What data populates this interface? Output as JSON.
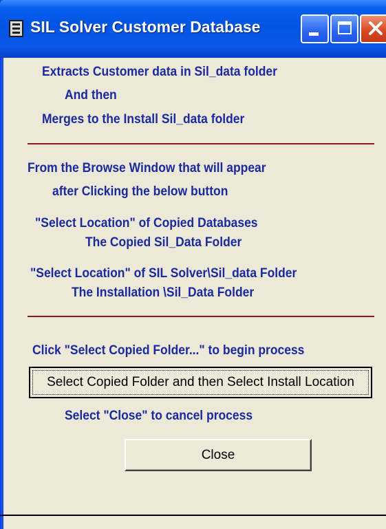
{
  "window": {
    "title": "SIL Solver Customer Database",
    "icon": "database-app-icon",
    "controls": [
      "minimize-icon",
      "maximize-icon",
      "close-icon"
    ]
  },
  "intro": {
    "line1": "Extracts Customer data in Sil_data folder",
    "line2": "And then",
    "line3": "Merges to the Install Sil_data folder"
  },
  "instructions": {
    "line1": "From the Browse Window that will appear",
    "line2": "after Clicking the below button",
    "line3": "\"Select Location\" of Copied Databases",
    "line4": "The Copied Sil_Data Folder",
    "line5": "\"Select Location\" of SIL Solver\\Sil_data Folder",
    "line6": "The Installation \\Sil_Data Folder"
  },
  "action": {
    "prompt": "Click \"Select Copied Folder...\"  to begin process",
    "button_label": "Select Copied Folder and then Select Install Location"
  },
  "cancel": {
    "prompt": "Select \"Close\" to cancel process",
    "button_label": "Close"
  },
  "colors": {
    "text": "#1a2a9e",
    "divider": "#8b1a1a",
    "background": "#ece9d8",
    "titlebar": "#0054e3"
  }
}
